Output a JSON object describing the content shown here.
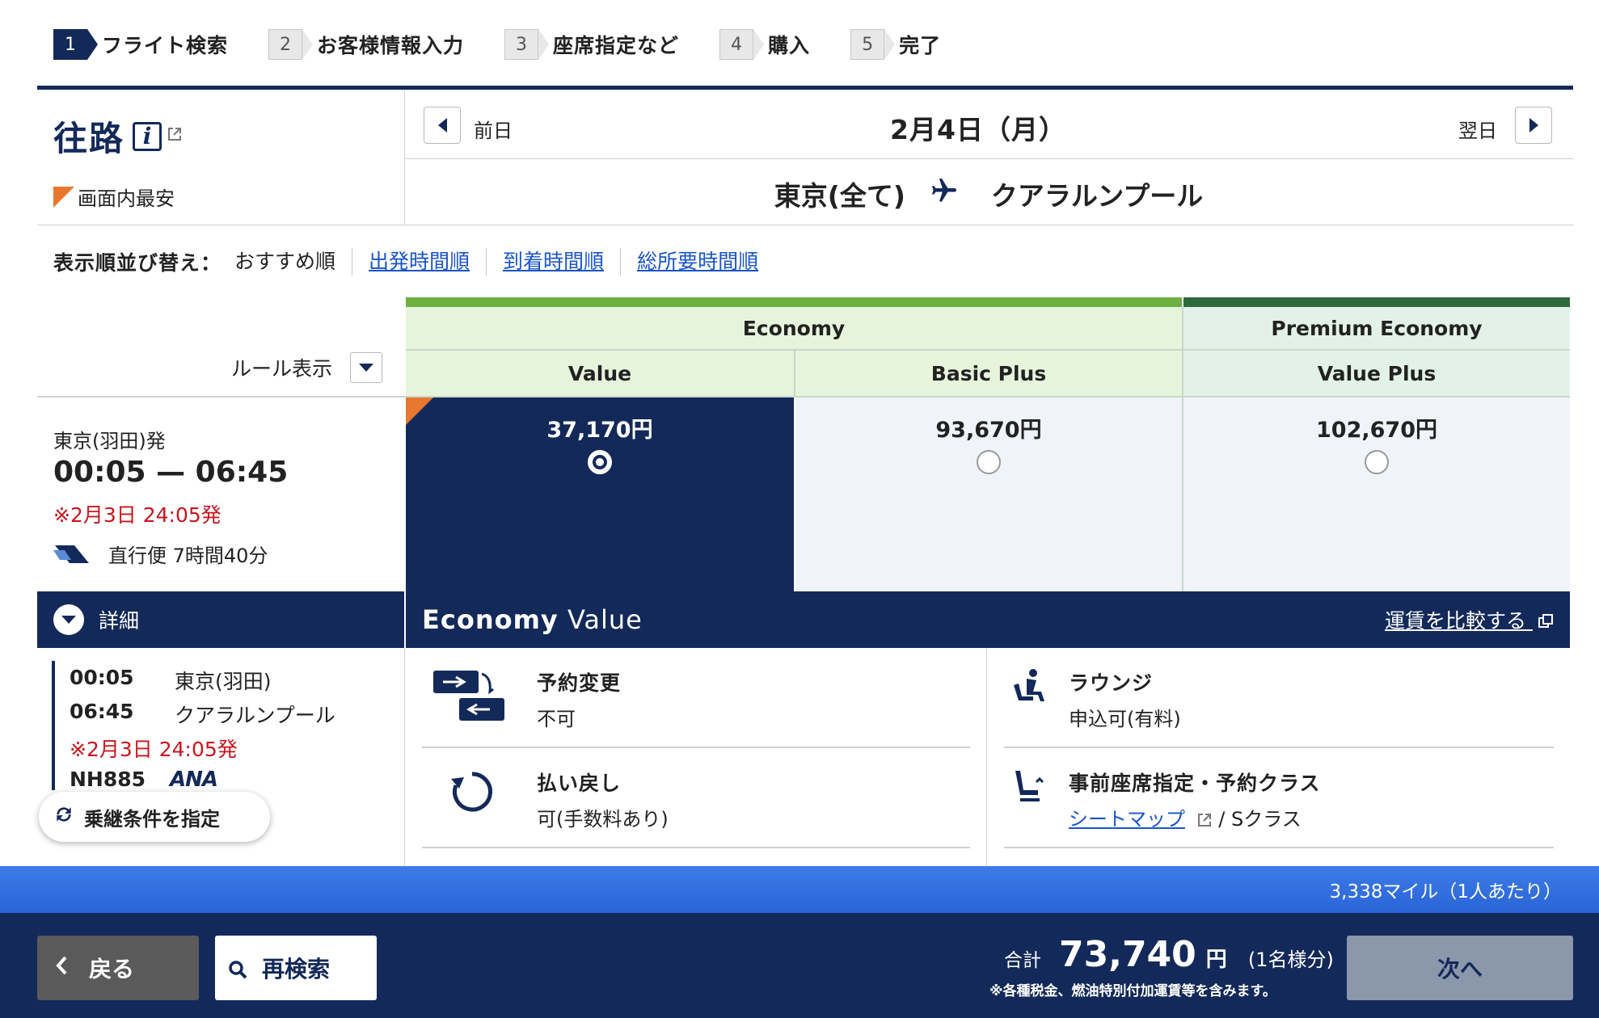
{
  "steps": [
    {
      "num": "1",
      "label": "フライト検索",
      "active": true
    },
    {
      "num": "2",
      "label": "お客様情報入力",
      "active": false
    },
    {
      "num": "3",
      "label": "座席指定など",
      "active": false
    },
    {
      "num": "4",
      "label": "購入",
      "active": false
    },
    {
      "num": "5",
      "label": "完了",
      "active": false
    }
  ],
  "header": {
    "title": "往路",
    "info_glyph": "i",
    "cheapest_label": "画面内最安",
    "prev_label": "前日",
    "next_label": "翌日",
    "date": "2月4日（月）",
    "origin": "東京(全て)",
    "destination": "クアラルンプール"
  },
  "sort": {
    "label": "表示順並び替え：",
    "options": [
      "おすすめ順",
      "出発時間順",
      "到着時間順",
      "総所要時間順"
    ]
  },
  "fares": {
    "rule_label": "ルール表示",
    "cabins": [
      "Economy",
      "Premium Economy"
    ],
    "columns": [
      {
        "name": "Value",
        "price": "37,170円",
        "selected": true
      },
      {
        "name": "Basic Plus",
        "price": "93,670円",
        "selected": false
      },
      {
        "name": "Value Plus",
        "price": "102,670円",
        "selected": false
      }
    ]
  },
  "flight": {
    "departure_airport": "東京(羽田)発",
    "times": "00:05 — 06:45",
    "note": "※2月3日 24:05発",
    "direct": "直行便 7時間40分",
    "detail_label": "詳細",
    "segments": [
      {
        "time": "00:05",
        "place": "東京(羽田)"
      },
      {
        "time": "06:45",
        "place": "クアラルンプール"
      }
    ],
    "segment_note": "※2月3日 24:05発",
    "flight_no": "NH885",
    "airline_logo_text": "ANA",
    "connect_label": "乗継条件を指定"
  },
  "selected_fare": {
    "title_bold": "Economy",
    "title_rest": " Value",
    "compare_label": "運賃を比較する",
    "conditions": {
      "change": {
        "title": "予約変更",
        "value": "不可"
      },
      "refund": {
        "title": "払い戻し",
        "value": "可(手数料あり)"
      },
      "lounge": {
        "title": "ラウンジ",
        "value": "申込可(有料)"
      },
      "seat": {
        "title": "事前座席指定・予約クラス",
        "link": "シートマップ",
        "value": " / Sクラス"
      }
    }
  },
  "footer": {
    "miles": "3,338マイル（1人あたり）",
    "back_label": "戻る",
    "research_label": "再検索",
    "total_label": "合計",
    "total_amount": "73,740",
    "total_unit": "円",
    "per_person": "(1名様分)",
    "tax_note": "※各種税金、燃油特別付加運賃等を含みます。",
    "next_label": "次へ"
  },
  "colors": {
    "navy": "#13295a",
    "link": "#1a54c8",
    "economy_green": "#6eb142",
    "premium_green": "#2e6b3a",
    "cheapest_orange": "#e8782e",
    "alert_red": "#c8161d",
    "miles_blue": "#2a64d6"
  }
}
